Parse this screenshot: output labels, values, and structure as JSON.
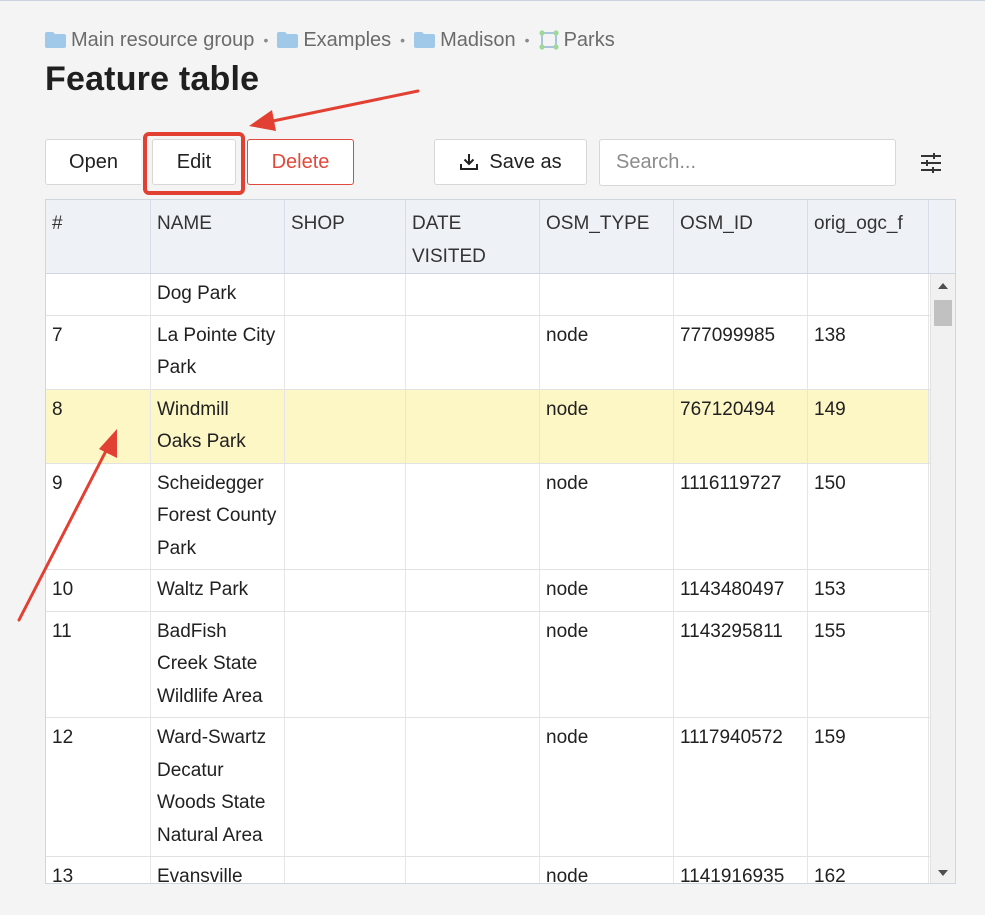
{
  "breadcrumb": {
    "items": [
      {
        "label": "Main resource group",
        "icon": "folder-icon"
      },
      {
        "label": "Examples",
        "icon": "folder-icon"
      },
      {
        "label": "Madison",
        "icon": "folder-icon"
      },
      {
        "label": "Parks",
        "icon": "vector-layer-icon"
      }
    ],
    "separator": "•"
  },
  "page": {
    "title": "Feature table"
  },
  "toolbar": {
    "open_label": "Open",
    "edit_label": "Edit",
    "delete_label": "Delete",
    "save_as_label": "Save as",
    "search_placeholder": "Search...",
    "settings_icon": "sliders-icon"
  },
  "table": {
    "columns": [
      "#",
      "NAME",
      "SHOP",
      "DATE VISITED",
      "OSM_TYPE",
      "OSM_ID",
      "orig_ogc_f"
    ],
    "rows": [
      {
        "num": "",
        "name": "Dog Park",
        "shop": "",
        "date_visited": "",
        "osm_type": "",
        "osm_id": "",
        "orig": ""
      },
      {
        "num": "7",
        "name": "La Pointe City Park",
        "shop": "",
        "date_visited": "",
        "osm_type": "node",
        "osm_id": "777099985",
        "orig": "138"
      },
      {
        "num": "8",
        "name": "Windmill Oaks Park",
        "shop": "",
        "date_visited": "",
        "osm_type": "node",
        "osm_id": "767120494",
        "orig": "149"
      },
      {
        "num": "9",
        "name": "Scheidegger Forest County Park",
        "shop": "",
        "date_visited": "",
        "osm_type": "node",
        "osm_id": "1116119727",
        "orig": "150"
      },
      {
        "num": "10",
        "name": "Waltz Park",
        "shop": "",
        "date_visited": "",
        "osm_type": "node",
        "osm_id": "1143480497",
        "orig": "153"
      },
      {
        "num": "11",
        "name": "BadFish Creek State Wildlife Area",
        "shop": "",
        "date_visited": "",
        "osm_type": "node",
        "osm_id": "1143295811",
        "orig": "155"
      },
      {
        "num": "12",
        "name": "Ward-Swartz Decatur Woods State Natural Area",
        "shop": "",
        "date_visited": "",
        "osm_type": "node",
        "osm_id": "1117940572",
        "orig": "159"
      },
      {
        "num": "13",
        "name": "Evansville",
        "shop": "",
        "date_visited": "",
        "osm_type": "node",
        "osm_id": "1141916935",
        "orig": "162"
      }
    ],
    "selected_row_num": "8"
  },
  "colors": {
    "accent_red": "#e24032",
    "delete_red": "#e04a3c",
    "highlight_row": "#fdf6c5",
    "header_bg": "#eef2f7",
    "folder_blue": "#9fc8e9"
  }
}
